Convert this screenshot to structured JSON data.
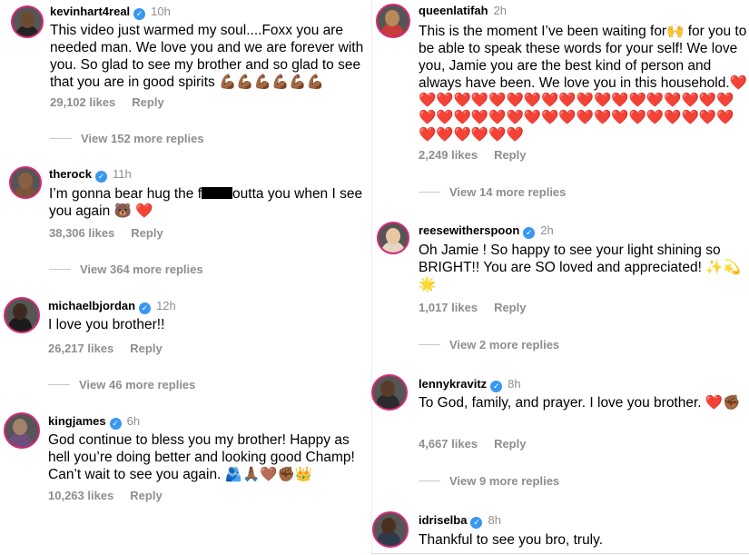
{
  "comments_left": [
    {
      "user": "kevinhart4real",
      "time": "10h",
      "text": "This video just warmed my soul....Foxx you are needed man. We love you and we are forever with you. So glad to see my brother and so glad to see that you are in good spirits 💪🏾💪🏾💪🏾💪🏾💪🏾💪🏾",
      "likes": "29,102 likes",
      "reply": "Reply",
      "more": "View 152 more replies"
    },
    {
      "user": "therock",
      "time": "11h",
      "text_before": "I’m gonna bear hug the f",
      "text_after": "outta you when I see you again 🐻 ❤️",
      "likes": "38,306 likes",
      "reply": "Reply",
      "more": "View 364 more replies"
    },
    {
      "user": "michaelbjordan",
      "time": "12h",
      "text": "I love you brother!!",
      "likes": "26,217 likes",
      "reply": "Reply",
      "more": "View 46 more replies"
    },
    {
      "user": "kingjames",
      "time": "6h",
      "text": "God continue to bless you my brother! Happy as hell you’re doing better and looking good Champ! Can’t wait to see you again. 🫂🙏🏾🤎✊🏾👑",
      "likes": "10,263 likes",
      "reply": "Reply"
    }
  ],
  "comments_right": [
    {
      "user": "queenlatifah",
      "time": "2h",
      "text": "This is the moment I’ve been waiting for🙌 for you to be able to speak these words for your self! We love you, Jamie you are the best kind of person and always have been. We love you in this household.❤️❤️❤️❤️❤️❤️❤️❤️❤️❤️❤️❤️❤️❤️❤️❤️❤️❤️❤️❤️❤️❤️❤️❤️❤️❤️❤️❤️❤️❤️❤️❤️❤️❤️❤️❤️❤️❤️❤️❤️❤️❤️❤️",
      "likes": "2,249 likes",
      "reply": "Reply",
      "more": "View 14 more replies"
    },
    {
      "user": "reesewitherspoon",
      "time": "2h",
      "text": "Oh Jamie !  So happy to see your light shining so BRIGHT!! You are SO loved and appreciated! ✨💫🌟",
      "likes": "1,017 likes",
      "reply": "Reply",
      "more": "View 2 more replies"
    },
    {
      "user": "lennykravitz",
      "time": "8h",
      "text": "To God, family, and prayer. I love you brother. ❤️✊🏾",
      "likes": "4,667 likes",
      "reply": "Reply",
      "more": "View 9 more replies"
    },
    {
      "user": "idriselba",
      "time": "8h",
      "text": "Thankful to see you bro, truly."
    }
  ],
  "colors": {
    "verified": "#3897f0",
    "meta": "#8e8e8e",
    "ring": "#d62976"
  }
}
